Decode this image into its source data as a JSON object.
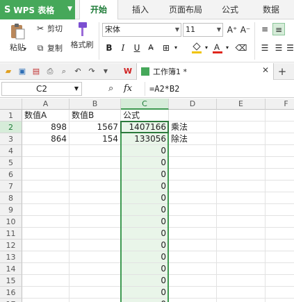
{
  "app": {
    "name": "WPS 表格"
  },
  "menu": {
    "tabs": [
      "开始",
      "插入",
      "页面布局",
      "公式",
      "数据"
    ],
    "active": 0
  },
  "ribbon": {
    "paste_label": "粘贴",
    "cut_label": "剪切",
    "copy_label": "复制",
    "format_painter_label": "格式刷",
    "font_name": "宋体",
    "font_size": "11",
    "bold": "B",
    "italic": "I",
    "underline": "U",
    "grow_font": "A⁺",
    "shrink_font": "A⁻"
  },
  "document": {
    "tab_title": "工作簿1 *"
  },
  "formula_bar": {
    "name_box": "C2",
    "fx_label": "fx",
    "formula": "=A2*B2"
  },
  "sheet": {
    "columns": [
      "A",
      "B",
      "C",
      "D",
      "E",
      "F"
    ],
    "selected_column": "C",
    "rows": [
      {
        "n": "1",
        "cells": [
          "数值A",
          "数值B",
          "公式",
          "",
          "",
          ""
        ]
      },
      {
        "n": "2",
        "cells": [
          "898",
          "1567",
          "1407166",
          "乘法",
          "",
          ""
        ]
      },
      {
        "n": "3",
        "cells": [
          "864",
          "154",
          "133056",
          "除法",
          "",
          ""
        ]
      },
      {
        "n": "4",
        "cells": [
          "",
          "",
          "0",
          "",
          "",
          ""
        ]
      },
      {
        "n": "5",
        "cells": [
          "",
          "",
          "0",
          "",
          "",
          ""
        ]
      },
      {
        "n": "6",
        "cells": [
          "",
          "",
          "0",
          "",
          "",
          ""
        ]
      },
      {
        "n": "7",
        "cells": [
          "",
          "",
          "0",
          "",
          "",
          ""
        ]
      },
      {
        "n": "8",
        "cells": [
          "",
          "",
          "0",
          "",
          "",
          ""
        ]
      },
      {
        "n": "9",
        "cells": [
          "",
          "",
          "0",
          "",
          "",
          ""
        ]
      },
      {
        "n": "10",
        "cells": [
          "",
          "",
          "0",
          "",
          "",
          ""
        ]
      },
      {
        "n": "11",
        "cells": [
          "",
          "",
          "0",
          "",
          "",
          ""
        ]
      },
      {
        "n": "12",
        "cells": [
          "",
          "",
          "0",
          "",
          "",
          ""
        ]
      },
      {
        "n": "13",
        "cells": [
          "",
          "",
          "0",
          "",
          "",
          ""
        ]
      },
      {
        "n": "14",
        "cells": [
          "",
          "",
          "0",
          "",
          "",
          ""
        ]
      },
      {
        "n": "15",
        "cells": [
          "",
          "",
          "0",
          "",
          "",
          ""
        ]
      },
      {
        "n": "16",
        "cells": [
          "",
          "",
          "0",
          "",
          "",
          ""
        ]
      },
      {
        "n": "17",
        "cells": [
          "",
          "",
          "0",
          "",
          "",
          ""
        ]
      }
    ]
  },
  "colors": {
    "accent": "#46a85a",
    "selection": "#3f9a52",
    "selection_fill": "#e9f5e9"
  }
}
